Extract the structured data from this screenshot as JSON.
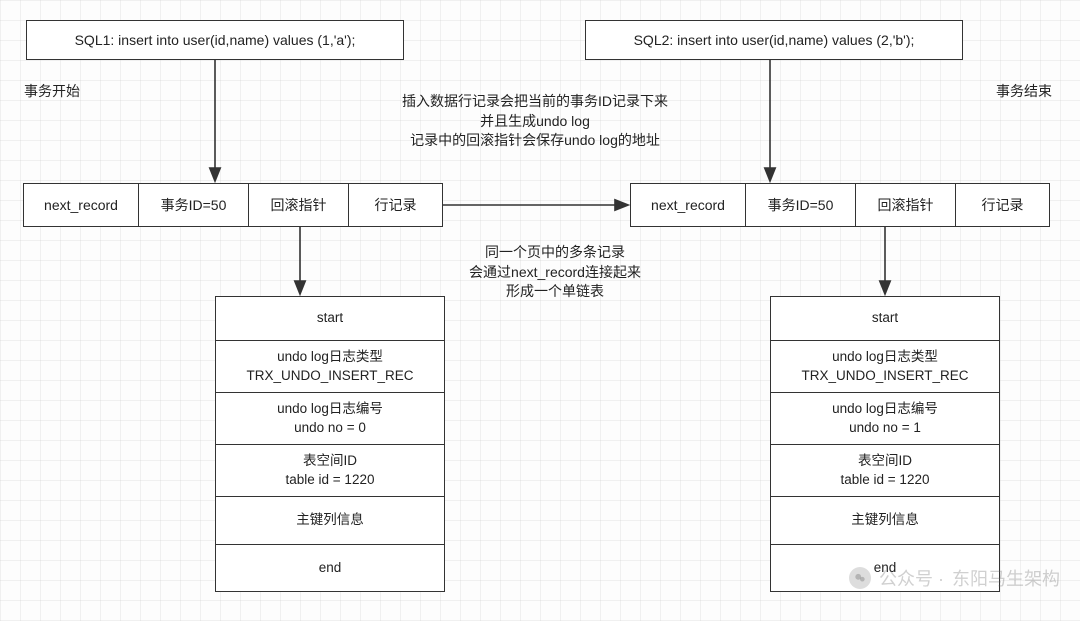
{
  "sql1": {
    "text": "SQL1: insert into user(id,name) values (1,'a');"
  },
  "sql2": {
    "text": "SQL2: insert into user(id,name) values (2,'b');"
  },
  "labels": {
    "tx_start": "事务开始",
    "tx_end": "事务结束",
    "note_top": "插入数据行记录会把当前的事务ID记录下来\n并且生成undo log\n记录中的回滚指针会保存undo log的地址",
    "note_mid": "同一个页中的多条记录\n会通过next_record连接起来\n形成一个单链表"
  },
  "row1": {
    "cells": [
      "next_record",
      "事务ID=50",
      "回滚指针",
      "行记录"
    ]
  },
  "row2": {
    "cells": [
      "next_record",
      "事务ID=50",
      "回滚指针",
      "行记录"
    ]
  },
  "undo1": {
    "rows": [
      "start",
      "undo log日志类型\nTRX_UNDO_INSERT_REC",
      "undo log日志编号\nundo no = 0",
      "表空间ID\ntable id = 1220",
      "主键列信息",
      "end"
    ]
  },
  "undo2": {
    "rows": [
      "start",
      "undo log日志类型\nTRX_UNDO_INSERT_REC",
      "undo log日志编号\nundo no = 1",
      "表空间ID\ntable id = 1220",
      "主键列信息",
      "end"
    ]
  },
  "watermark": {
    "prefix": "公众号 · ",
    "name": "东阳马生架构"
  }
}
